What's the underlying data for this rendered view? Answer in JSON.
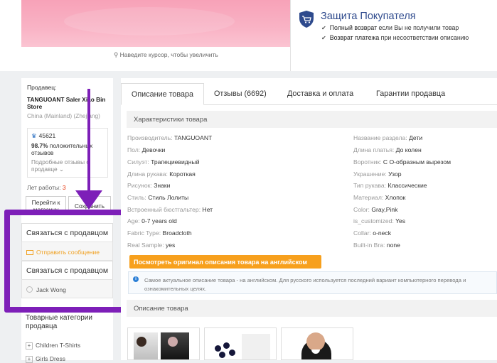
{
  "zoom_hint": "Наведите курсор, чтобы увеличить",
  "protection": {
    "title": "Защита Покупателя",
    "line1_bold": "Полный возврат",
    "line1_rest": " если Вы не получили товар",
    "line2_bold": "Возврат платежа",
    "line2_rest": " при несоответствии описанию"
  },
  "seller": {
    "label": "Продавец:",
    "store": "TANGUOANT Saler Xiao Bin Store",
    "country": "China (Mainland) (Zhejiang)",
    "feedback_score": "45621",
    "positive_pct": "98.7%",
    "positive_text": " положительных отзывов",
    "details_link": "Подробные отзывы о продавце",
    "years_label": "Лет работы: ",
    "years_value": "3",
    "go_store": "Перейти к магазину",
    "save": "Сохранить",
    "contact1": "Связаться с продавцом",
    "send_message": "Отправить сообщение",
    "contact2": "Связаться с продавцом",
    "agent_name": "Jack Wong"
  },
  "categories": {
    "title": "Товарные категории продавца",
    "items": [
      "Children T-Shirts",
      "Girls Dress"
    ]
  },
  "tabs": [
    "Описание товара",
    "Отзывы (6692)",
    "Доставка и оплата",
    "Гарантии продавца"
  ],
  "specs_title": "Характеристики товара",
  "specs_left": [
    {
      "k": "Производитель:",
      "v": "TANGUOANT"
    },
    {
      "k": "Пол:",
      "v": "Девочки"
    },
    {
      "k": "Силуэт:",
      "v": "Трапециевидный"
    },
    {
      "k": "Длина рукава:",
      "v": "Короткая"
    },
    {
      "k": "Рисунок:",
      "v": "Знаки"
    },
    {
      "k": "Стиль:",
      "v": "Стиль Лолиты"
    },
    {
      "k": "Встроенный бюстгальтер:",
      "v": "Нет"
    },
    {
      "k": "Age:",
      "v": "0-7 years old"
    },
    {
      "k": "Fabric Type:",
      "v": "Broadcloth"
    },
    {
      "k": "Real Sample:",
      "v": "yes"
    }
  ],
  "specs_right": [
    {
      "k": "Название раздела:",
      "v": "Дети"
    },
    {
      "k": "Длина платья:",
      "v": "До колен"
    },
    {
      "k": "Воротник:",
      "v": "С О-образным вырезом"
    },
    {
      "k": "Украшение:",
      "v": "Узор"
    },
    {
      "k": "Тип рукава:",
      "v": "Классические"
    },
    {
      "k": "Материал:",
      "v": "Хлопок"
    },
    {
      "k": "Color:",
      "v": "Gray,Pink"
    },
    {
      "k": "is_customized:",
      "v": "Yes"
    },
    {
      "k": "Collar:",
      "v": "o-neck"
    },
    {
      "k": "Built-in Bra:",
      "v": "none"
    }
  ],
  "orange_button": "Посмотреть оригинал описания товара на английском",
  "info_text": "Самое актуальное описание товара - на английском. Для русского используется последний вариант компьютерного перевода и ознакомительных целях.",
  "description_title": "Описание товара",
  "colors": {
    "accent_purple": "#7d1fb8",
    "orange": "#f7a01d",
    "title_blue": "#2e4a8d"
  }
}
